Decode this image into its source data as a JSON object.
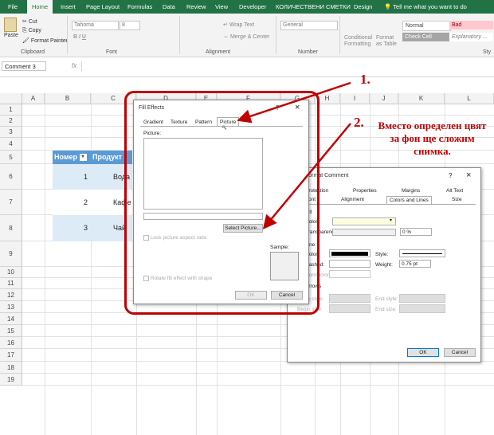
{
  "ribbon": {
    "tabs": [
      "File",
      "Home",
      "Insert",
      "Page Layout",
      "Formulas",
      "Data",
      "Review",
      "View",
      "Developer",
      "КОЛИЧЕСТВЕНИ СМЕТКИ",
      "Design"
    ],
    "tell_me": "Tell me what you want to do",
    "clipboard": {
      "paste": "Paste",
      "cut": "Cut",
      "copy": "Copy",
      "format_painter": "Format Painter",
      "label": "Clipboard"
    },
    "font": {
      "name": "Tahoma",
      "size": "8",
      "label": "Font"
    },
    "alignment": {
      "wrap_text": "Wrap Text",
      "merge": "Merge & Center",
      "label": "Alignment"
    },
    "number": {
      "format": "General",
      "label": "Number"
    },
    "styles": {
      "conditional": "Conditional Formatting",
      "format_table": "Format as Table",
      "normal": "Normal",
      "bad": "Bad",
      "check_cell": "Check Cell",
      "explanatory": "Explanatory ...",
      "label": "Sty"
    }
  },
  "formula_bar": {
    "name_box": "Comment 3",
    "fx": "fx"
  },
  "sheet": {
    "columns": [
      "A",
      "B",
      "C",
      "D",
      "E",
      "F",
      "G",
      "H",
      "I",
      "J",
      "K",
      "L"
    ],
    "rows": [
      "1",
      "2",
      "3",
      "4",
      "5",
      "6",
      "7",
      "8",
      "9",
      "10",
      "11",
      "12",
      "13",
      "14",
      "15",
      "16",
      "17",
      "18",
      "19"
    ],
    "table": {
      "headers": [
        "Номер",
        "Продукт"
      ],
      "rows": [
        {
          "num": "1",
          "product": "Вода"
        },
        {
          "num": "2",
          "product": "Кафе"
        },
        {
          "num": "3",
          "product": "Чай"
        }
      ]
    }
  },
  "fill_effects": {
    "title": "Fill Effects",
    "help": "?",
    "close": "×",
    "tabs": [
      "Gradient",
      "Texture",
      "Pattern",
      "Picture"
    ],
    "picture_label": "Picture:",
    "select_picture": "Select Picture...",
    "lock_ratio": "Lock picture aspect ratio",
    "rotate": "Rotate fill effect with shape",
    "sample": "Sample:",
    "ok": "OK",
    "cancel": "Cancel"
  },
  "format_comment": {
    "title": "Format Comment",
    "help": "?",
    "close": "×",
    "tabs_row1": [
      "Protection",
      "Properties",
      "Margins",
      "Alt Text"
    ],
    "tabs_row2": [
      "Font",
      "Alignment",
      "Colors and Lines",
      "Size"
    ],
    "fill_label": "Fill",
    "color": "Color:",
    "transparency": "Transparency:",
    "transparency_value": "0 %",
    "line_label": "Line",
    "line_color": "Color:",
    "dashed": "Dashed:",
    "connector": "Connector:",
    "style": "Style:",
    "weight": "Weight:",
    "weight_value": "0.75 pt",
    "arrows_label": "Arrows",
    "begin_style": "Begin style:",
    "begin_size": "Begin size:",
    "end_style": "End style:",
    "end_size": "End size:",
    "ok": "OK",
    "cancel": "Cancel"
  },
  "annotations": {
    "step1": "1.",
    "step2": "2.",
    "note": "Вместо определен цвят за фон ще сложим снимка."
  },
  "colors": {
    "excel_green": "#217346",
    "table_header": "#5b9bd5",
    "table_band": "#ddebf7",
    "annotation": "#c00000"
  }
}
